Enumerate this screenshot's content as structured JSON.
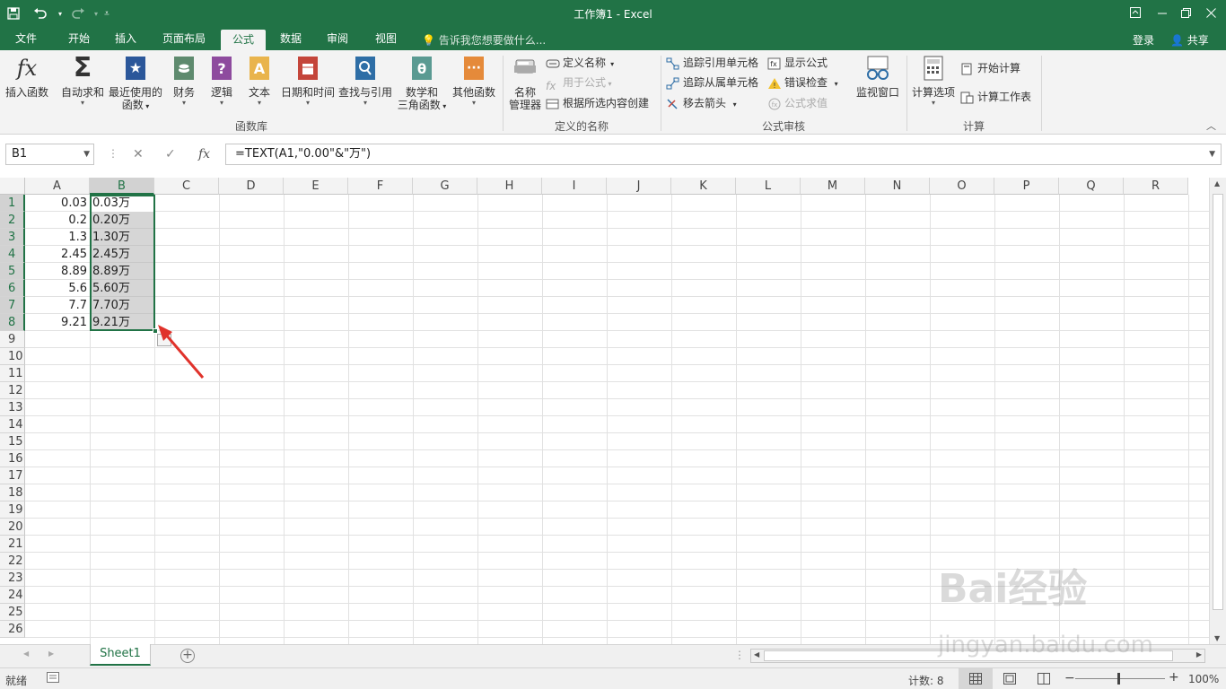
{
  "window": {
    "title": "工作簿1 - Excel",
    "qa_save_icon": "save-icon",
    "qa_undo_icon": "undo-icon",
    "qa_redo_icon": "redo-icon"
  },
  "tabs": {
    "items": [
      "文件",
      "开始",
      "插入",
      "页面布局",
      "公式",
      "数据",
      "审阅",
      "视图"
    ],
    "active": "公式",
    "tell_me": "告诉我您想要做什么...",
    "login": "登录",
    "share": "共享"
  },
  "ribbon": {
    "function_library": {
      "label": "函数库",
      "buttons": [
        "插入函数",
        "自动求和",
        "最近使用的",
        "函数",
        "财务",
        "逻辑",
        "文本",
        "日期和时间",
        "查找与引用",
        "数学和",
        "三角函数",
        "其他函数"
      ]
    },
    "defined_names": {
      "label": "定义的名称",
      "manager": [
        "名称",
        "管理器"
      ],
      "define_name": "定义名称",
      "use_in_formula": "用于公式",
      "create_from_selection": "根据所选内容创建"
    },
    "formula_auditing": {
      "label": "公式审核",
      "trace_precedents": "追踪引用单元格",
      "trace_dependents": "追踪从属单元格",
      "remove_arrows": "移去箭头",
      "show_formulas": "显示公式",
      "error_checking": "错误检查",
      "evaluate_formula": "公式求值",
      "watch_window": "监视窗口"
    },
    "calculation": {
      "label": "计算",
      "options": "计算选项",
      "calc_now": "开始计算",
      "calc_sheet": "计算工作表"
    }
  },
  "formula_bar": {
    "name_box": "B1",
    "formula": "=TEXT(A1,\"0.00\"&\"万\")",
    "cancel": "✕",
    "enter": "✓",
    "fx": "fx"
  },
  "sheet": {
    "columns": [
      "A",
      "B",
      "C",
      "D",
      "E",
      "F",
      "G",
      "H",
      "I",
      "J",
      "K",
      "L",
      "M",
      "N",
      "O",
      "P",
      "Q",
      "R"
    ],
    "rows": [
      "1",
      "2",
      "3",
      "4",
      "5",
      "6",
      "7",
      "8",
      "9",
      "10",
      "11",
      "12",
      "13",
      "14",
      "15",
      "16",
      "17",
      "18",
      "19",
      "20",
      "21",
      "22",
      "23",
      "24",
      "25",
      "26"
    ],
    "colA": [
      "0.03",
      "0.2",
      "1.3",
      "2.45",
      "8.89",
      "5.6",
      "7.7",
      "9.21"
    ],
    "colB": [
      "0.03万",
      "0.20万",
      "1.30万",
      "2.45万",
      "8.89万",
      "5.60万",
      "7.70万",
      "9.21万"
    ],
    "selected_range": "B1:B8",
    "tab_name": "Sheet1"
  },
  "status": {
    "ready": "就绪",
    "count": "计数: 8",
    "zoom": "100%"
  },
  "watermark": {
    "line1": "Bai经验",
    "line2": "jingyan.baidu.com"
  }
}
